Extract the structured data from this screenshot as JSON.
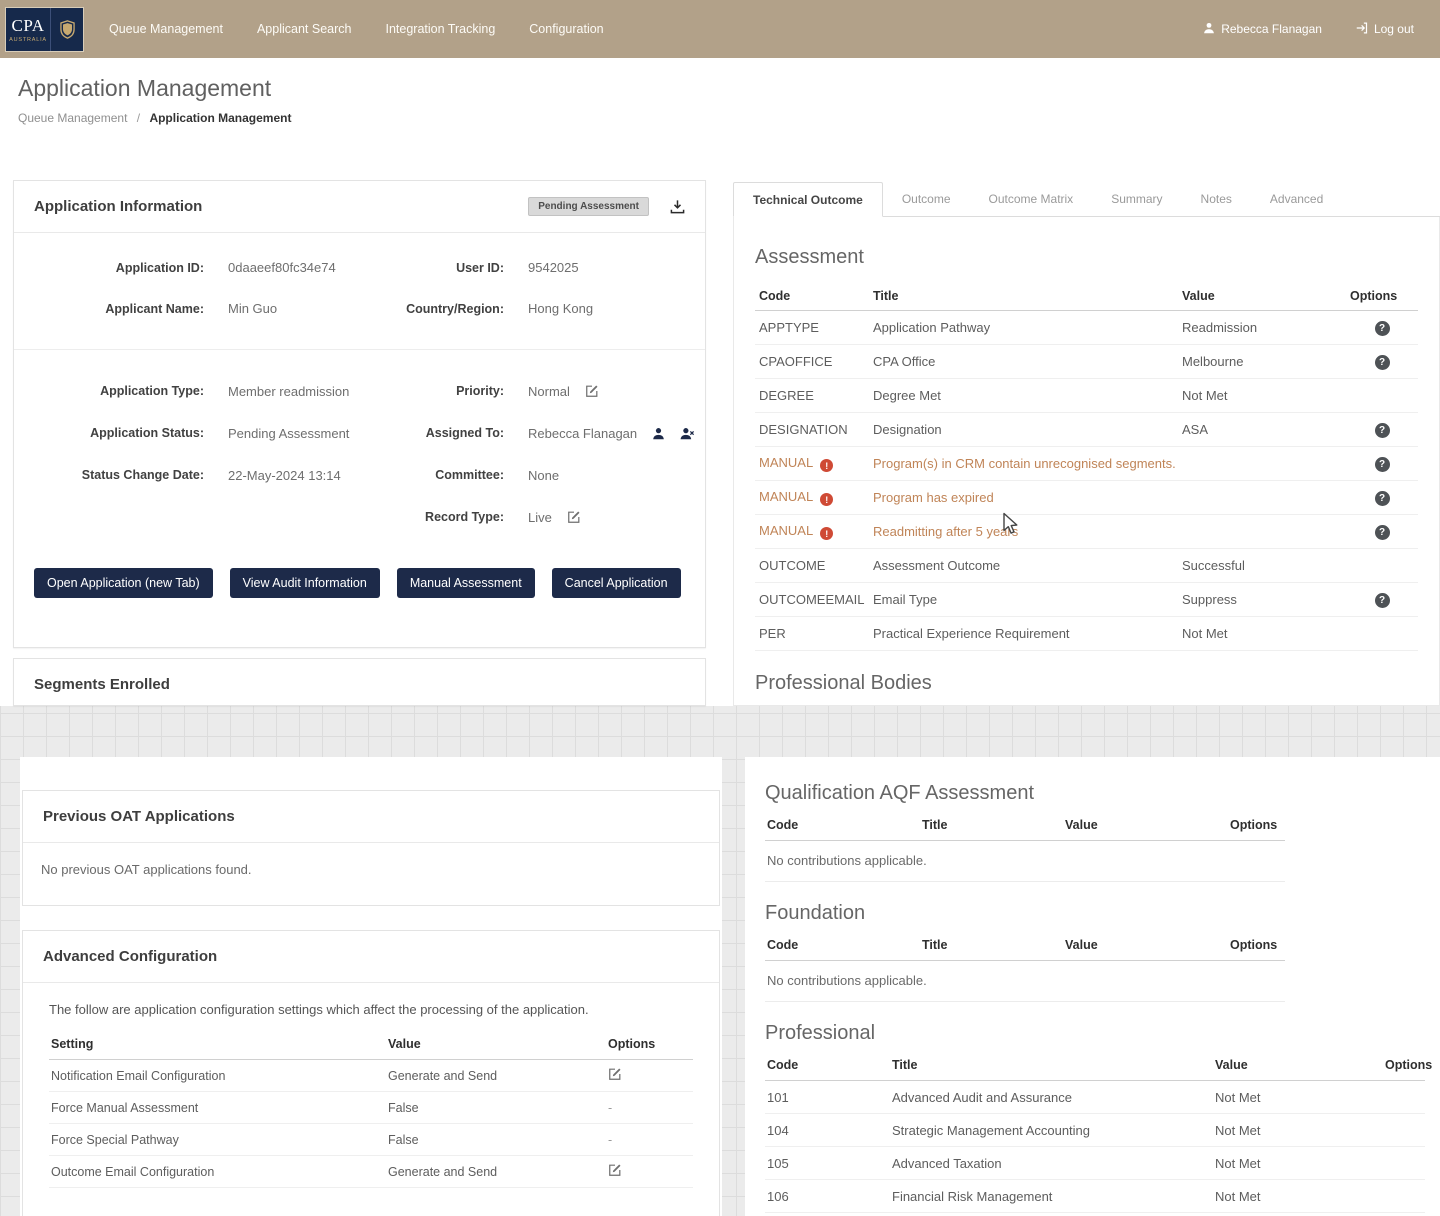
{
  "icons": {
    "help": "?",
    "warning": "!"
  },
  "navbar": {
    "brand_cpa": "CPA",
    "brand_australia": "AUSTRALIA",
    "items": [
      "Queue Management",
      "Applicant Search",
      "Integration Tracking",
      "Configuration"
    ],
    "user_name": "Rebecca Flanagan",
    "logout_label": "Log out"
  },
  "page": {
    "title": "Application Management",
    "breadcrumb_parent": "Queue Management",
    "breadcrumb_separator": "/",
    "breadcrumb_current": "Application Management"
  },
  "application_info": {
    "title": "Application Information",
    "status_badge": "Pending Assessment",
    "fields": {
      "application_id_label": "Application ID:",
      "application_id": "0daaeef80fc34e74",
      "user_id_label": "User ID:",
      "user_id": "9542025",
      "applicant_name_label": "Applicant Name:",
      "applicant_name": "Min Guo",
      "country_label": "Country/Region:",
      "country": "Hong Kong",
      "application_type_label": "Application Type:",
      "application_type": "Member readmission",
      "priority_label": "Priority:",
      "priority": "Normal",
      "application_status_label": "Application Status:",
      "application_status": "Pending Assessment",
      "assigned_to_label": "Assigned To:",
      "assigned_to": "Rebecca Flanagan",
      "status_change_date_label": "Status Change Date:",
      "status_change_date": "22-May-2024 13:14",
      "committee_label": "Committee:",
      "committee": "None",
      "record_type_label": "Record Type:",
      "record_type": "Live"
    },
    "buttons": {
      "open": "Open Application (new Tab)",
      "audit": "View Audit Information",
      "manual": "Manual Assessment",
      "cancel": "Cancel Application"
    }
  },
  "segments": {
    "title": "Segments Enrolled"
  },
  "outcome_panel": {
    "tabs": [
      {
        "label": "Technical Outcome",
        "active": true
      },
      {
        "label": "Outcome"
      },
      {
        "label": "Outcome Matrix"
      },
      {
        "label": "Summary"
      },
      {
        "label": "Notes"
      },
      {
        "label": "Advanced"
      }
    ],
    "assessment_heading": "Assessment",
    "columns": {
      "code": "Code",
      "title": "Title",
      "value": "Value",
      "options": "Options"
    },
    "assessment_rows": [
      {
        "code": "APPTYPE",
        "title": "Application Pathway",
        "value": "Readmission",
        "help": true
      },
      {
        "code": "CPAOFFICE",
        "title": "CPA Office",
        "value": "Melbourne",
        "help": true
      },
      {
        "code": "DEGREE",
        "title": "Degree Met",
        "value": "Not Met"
      },
      {
        "code": "DESIGNATION",
        "title": "Designation",
        "value": "ASA",
        "help": true
      },
      {
        "code": "MANUAL",
        "title": "Program(s) in CRM contain unrecognised segments.",
        "value": "",
        "warning": true,
        "help": true
      },
      {
        "code": "MANUAL",
        "title": "Program has expired",
        "value": "",
        "warning": true,
        "help": true
      },
      {
        "code": "MANUAL",
        "title": "Readmitting after 5 years",
        "value": "",
        "warning": true,
        "help": true
      },
      {
        "code": "OUTCOME",
        "title": "Assessment Outcome",
        "value": "Successful"
      },
      {
        "code": "OUTCOMEEMAIL",
        "title": "Email Type",
        "value": "Suppress",
        "help": true
      },
      {
        "code": "PER",
        "title": "Practical Experience Requirement",
        "value": "Not Met"
      }
    ],
    "professional_bodies_heading": "Professional Bodies"
  },
  "previous_oat": {
    "title": "Previous OAT Applications",
    "empty_text": "No previous OAT applications found."
  },
  "advanced_config": {
    "title": "Advanced Configuration",
    "description": "The follow are application configuration settings which affect the processing of the application.",
    "columns": {
      "setting": "Setting",
      "value": "Value",
      "options": "Options"
    },
    "rows": [
      {
        "setting": "Notification Email Configuration",
        "value": "Generate and Send",
        "edit": true
      },
      {
        "setting": "Force Manual Assessment",
        "value": "False",
        "dash": "-"
      },
      {
        "setting": "Force Special Pathway",
        "value": "False",
        "dash": "-"
      },
      {
        "setting": "Outcome Email Configuration",
        "value": "Generate and Send",
        "edit": true
      }
    ]
  },
  "qualification_panel": {
    "aqf_heading": "Qualification AQF Assessment",
    "aqf_empty": "No contributions applicable.",
    "foundation_heading": "Foundation",
    "foundation_empty": "No contributions applicable.",
    "professional_heading": "Professional",
    "columns": {
      "code": "Code",
      "title": "Title",
      "value": "Value",
      "options": "Options"
    },
    "professional_rows": [
      {
        "code": "101",
        "title": "Advanced Audit and Assurance",
        "value": "Not Met"
      },
      {
        "code": "104",
        "title": "Strategic Management Accounting",
        "value": "Not Met"
      },
      {
        "code": "105",
        "title": "Advanced Taxation",
        "value": "Not Met"
      },
      {
        "code": "106",
        "title": "Financial Risk Management",
        "value": "Not Met"
      }
    ]
  }
}
